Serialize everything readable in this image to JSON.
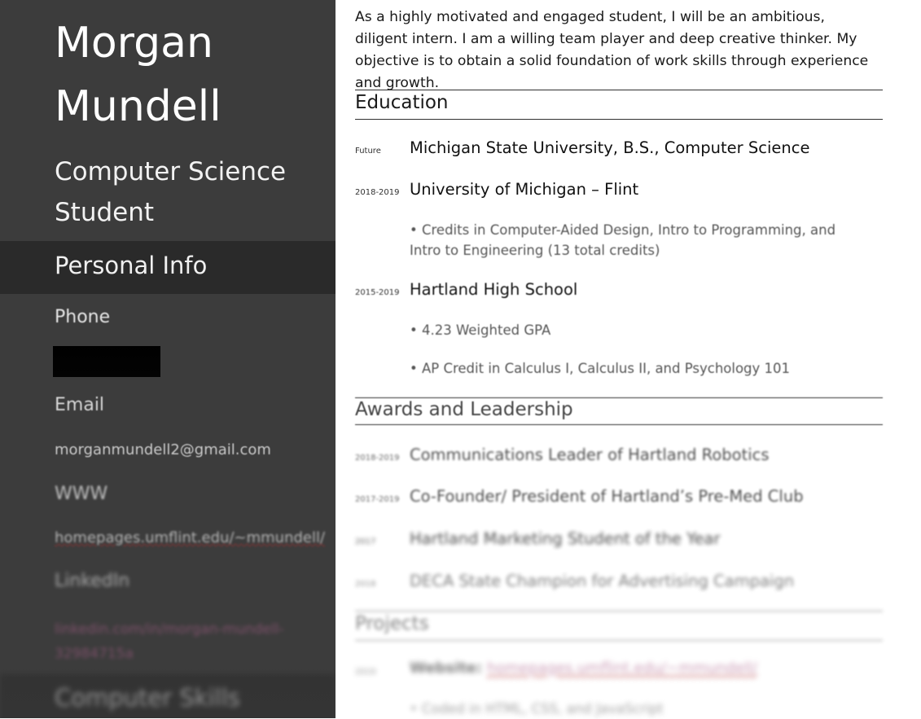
{
  "sidebar": {
    "name_line1": "Morgan",
    "name_line2": "Mundell",
    "subtitle_line1": "Computer Science",
    "subtitle_line2": "Student",
    "personal_info_heading": "Personal Info",
    "phone_label": "Phone",
    "email_label": "Email",
    "email_value": "morganmundell2@gmail.com",
    "www_label": "WWW",
    "www_value": "homepages.umflint.edu/~mmundell/",
    "linkedin_label": "LinkedIn",
    "linkedin_value_line1": "linkedin.com/in/morgan-mundell-",
    "linkedin_value_line2": "32984715a",
    "computer_skills_heading": "Computer Skills"
  },
  "main": {
    "objective": "As a highly motivated and engaged student, I will be an ambitious, diligent intern. I am a willing team player and deep creative thinker. My objective is to obtain a solid foundation of work skills through experience and growth.",
    "education": {
      "heading": "Education",
      "entries": [
        {
          "date": "Future",
          "title": "Michigan State University, B.S., Computer Science"
        },
        {
          "date": "2018-2019",
          "title": "University of Michigan – Flint",
          "bullets": [
            "• Credits in Computer-Aided Design, Intro to Programming, and Intro to Engineering (13 total credits)"
          ]
        },
        {
          "date": "2015-2019",
          "title": "Hartland High School",
          "bullets": [
            "• 4.23 Weighted GPA",
            "• AP Credit in Calculus I, Calculus II, and Psychology 101"
          ]
        }
      ]
    },
    "awards": {
      "heading": "Awards and Leadership",
      "entries": [
        {
          "date": "2018-2019",
          "title": "Communications Leader of Hartland Robotics"
        },
        {
          "date": "2017-2019",
          "title": "Co-Founder/ President of Hartland’s Pre-Med Club"
        },
        {
          "date": "2017",
          "title": "Hartland Marketing Student of the Year"
        },
        {
          "date": "2018",
          "title": "DECA State Champion for Advertising Campaign"
        }
      ]
    },
    "projects": {
      "heading": "Projects",
      "entries": [
        {
          "date": "2019",
          "title_prefix": "Website:",
          "link": "homepages.umflint.edu/~mmundell/",
          "bullets": [
            "• Coded in HTML, CSS, and JavaScript"
          ]
        }
      ]
    }
  },
  "colors": {
    "sidebar_bg": "#3c3c3c",
    "sidebar_band_bg": "#2a2a2a",
    "page_bg": "#ffffff",
    "text_dark": "#1a1a1a"
  }
}
